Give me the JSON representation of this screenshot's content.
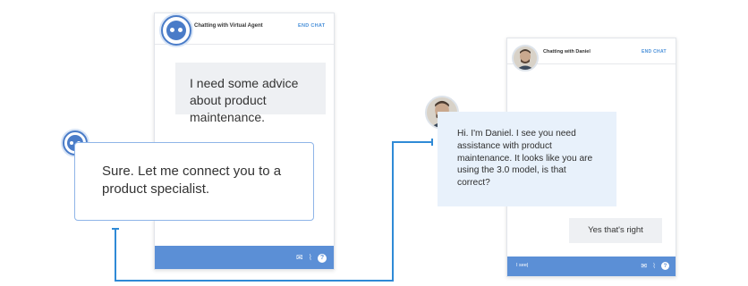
{
  "left_chat": {
    "header_title": "Chatting with Virtual Agent",
    "end_chat_label": "END CHAT",
    "user_message": "I need some advice about product maintenance.",
    "bot_message": "Sure. Let me connect you to a product specialist."
  },
  "right_chat": {
    "header_title": "Chatting with Daniel",
    "end_chat_label": "END CHAT",
    "agent_message": "Hi. I'm Daniel. I see you need assistance with product maintenance. It looks like you are using the 3.0 model, is that correct?",
    "user_reply": "Yes that's right",
    "input_value": "I see|"
  },
  "icons": {
    "mail": "mail-icon",
    "attach": "paperclip-icon",
    "help": "help-icon"
  },
  "colors": {
    "accent": "#5b8fd6",
    "connector": "#2f8ad6",
    "bubble_blue": "#e8f1fb",
    "bubble_grey": "#eef0f3"
  }
}
